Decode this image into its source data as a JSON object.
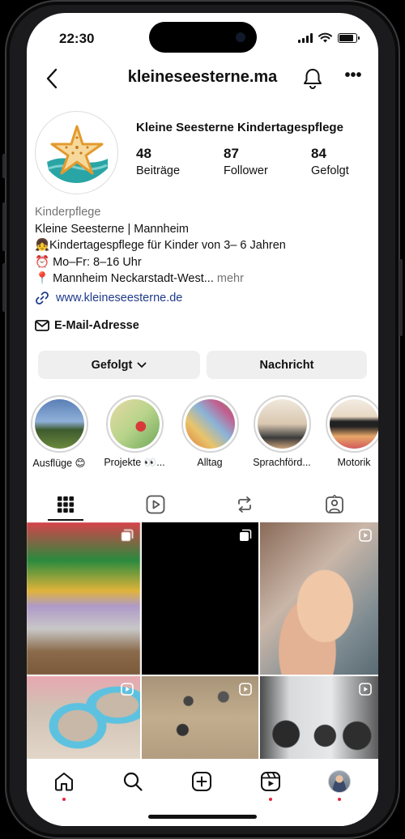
{
  "status": {
    "time": "22:30"
  },
  "header": {
    "username": "kleineseesterne.ma"
  },
  "profile": {
    "display_name": "Kleine Seesterne Kindertagespflege",
    "stats": [
      {
        "value": "48",
        "label": "Beiträge"
      },
      {
        "value": "87",
        "label": "Follower"
      },
      {
        "value": "84",
        "label": "Gefolgt"
      }
    ],
    "bio": {
      "category": "Kinderpflege",
      "line1": "Kleine Seesterne | Mannheim",
      "line2": "👧Kindertagespflege für Kinder von 3– 6 Jahren",
      "line3": "⏰ Mo–Fr: 8–16 Uhr",
      "line4": "📍 Mannheim Neckarstadt-West...",
      "more": "mehr"
    },
    "link": "www.kleineseesterne.de",
    "email_label": "E-Mail-Adresse"
  },
  "actions": {
    "follow_label": "Gefolgt",
    "message_label": "Nachricht"
  },
  "highlights": [
    {
      "label": "Ausflüge 😊"
    },
    {
      "label": "Projekte 👀..."
    },
    {
      "label": "Alltag"
    },
    {
      "label": "Sprachförd..."
    },
    {
      "label": "Motorik"
    }
  ],
  "tabs": [
    "grid-icon",
    "reels-icon",
    "reposts-icon",
    "tagged-icon"
  ],
  "grid_icons": [
    "multi-photo-icon",
    "multi-photo-icon",
    "reel-icon",
    "reel-icon",
    "reel-icon",
    "reel-icon"
  ],
  "colors": {
    "link": "#1e3a8a",
    "button_bg": "#efefef",
    "notification_dot": "#e5263f"
  }
}
